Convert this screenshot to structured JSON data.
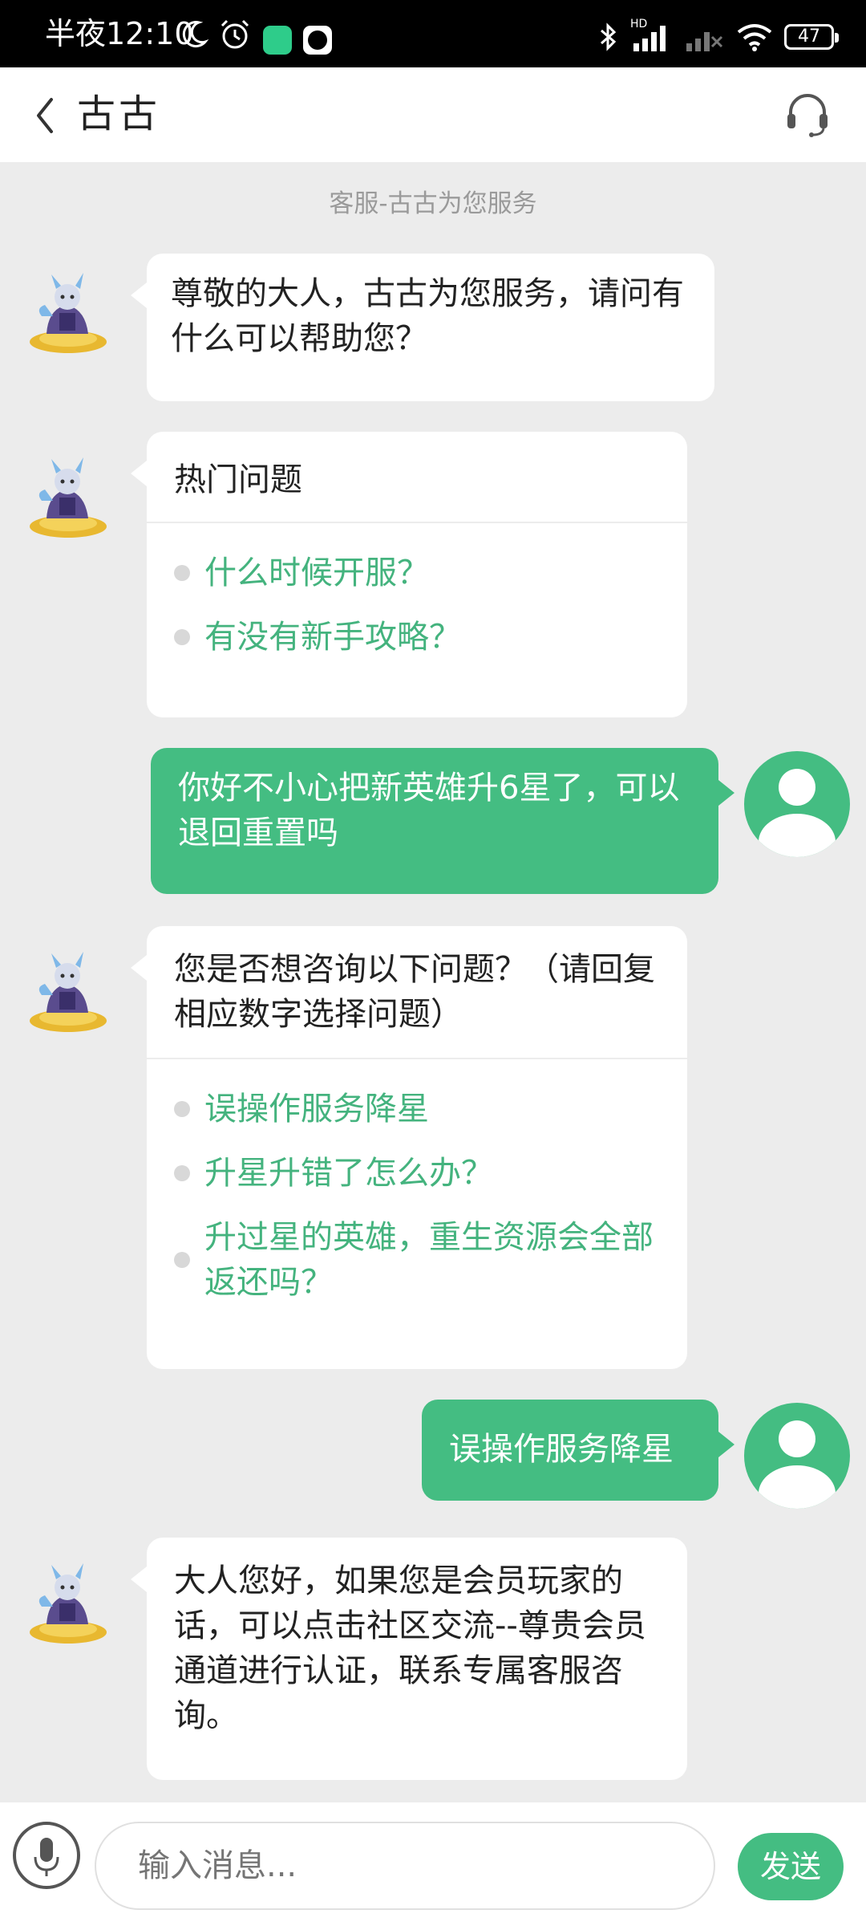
{
  "status_bar": {
    "time": "半夜12:10",
    "battery": "47",
    "network_label": "HD"
  },
  "header": {
    "title": "古古"
  },
  "chat": {
    "notice": "客服-古古为您服务",
    "greeting": "尊敬的大人，古古为您服务，请问有什么可以帮助您？",
    "hot_card": {
      "title": "热门问题",
      "items": [
        "什么时候开服？",
        "有没有新手攻略？"
      ]
    },
    "user_message_1": "你好不小心把新英雄升6星了，可以退回重置吗",
    "suggest_card": {
      "title": "您是否想咨询以下问题？（请回复相应数字选择问题）",
      "items": [
        "误操作服务降星",
        "升星升错了怎么办？",
        "升过星的英雄，重生资源会全部返还吗？"
      ]
    },
    "user_message_2": "误操作服务降星",
    "reply": "大人您好，如果您是会员玩家的话，可以点击社区交流--尊贵会员通道进行认证，联系专属客服咨询。"
  },
  "input_bar": {
    "placeholder": "输入消息...",
    "send_label": "发送"
  },
  "colors": {
    "accent": "#44bd82",
    "link": "#44b37e",
    "background": "#ececec"
  },
  "icons": [
    "moon-icon",
    "alarm-icon",
    "bluetooth-icon",
    "signal-icon",
    "wifi-icon",
    "battery-icon",
    "back-icon",
    "headset-icon",
    "mic-icon",
    "user-avatar-icon",
    "bot-avatar"
  ]
}
